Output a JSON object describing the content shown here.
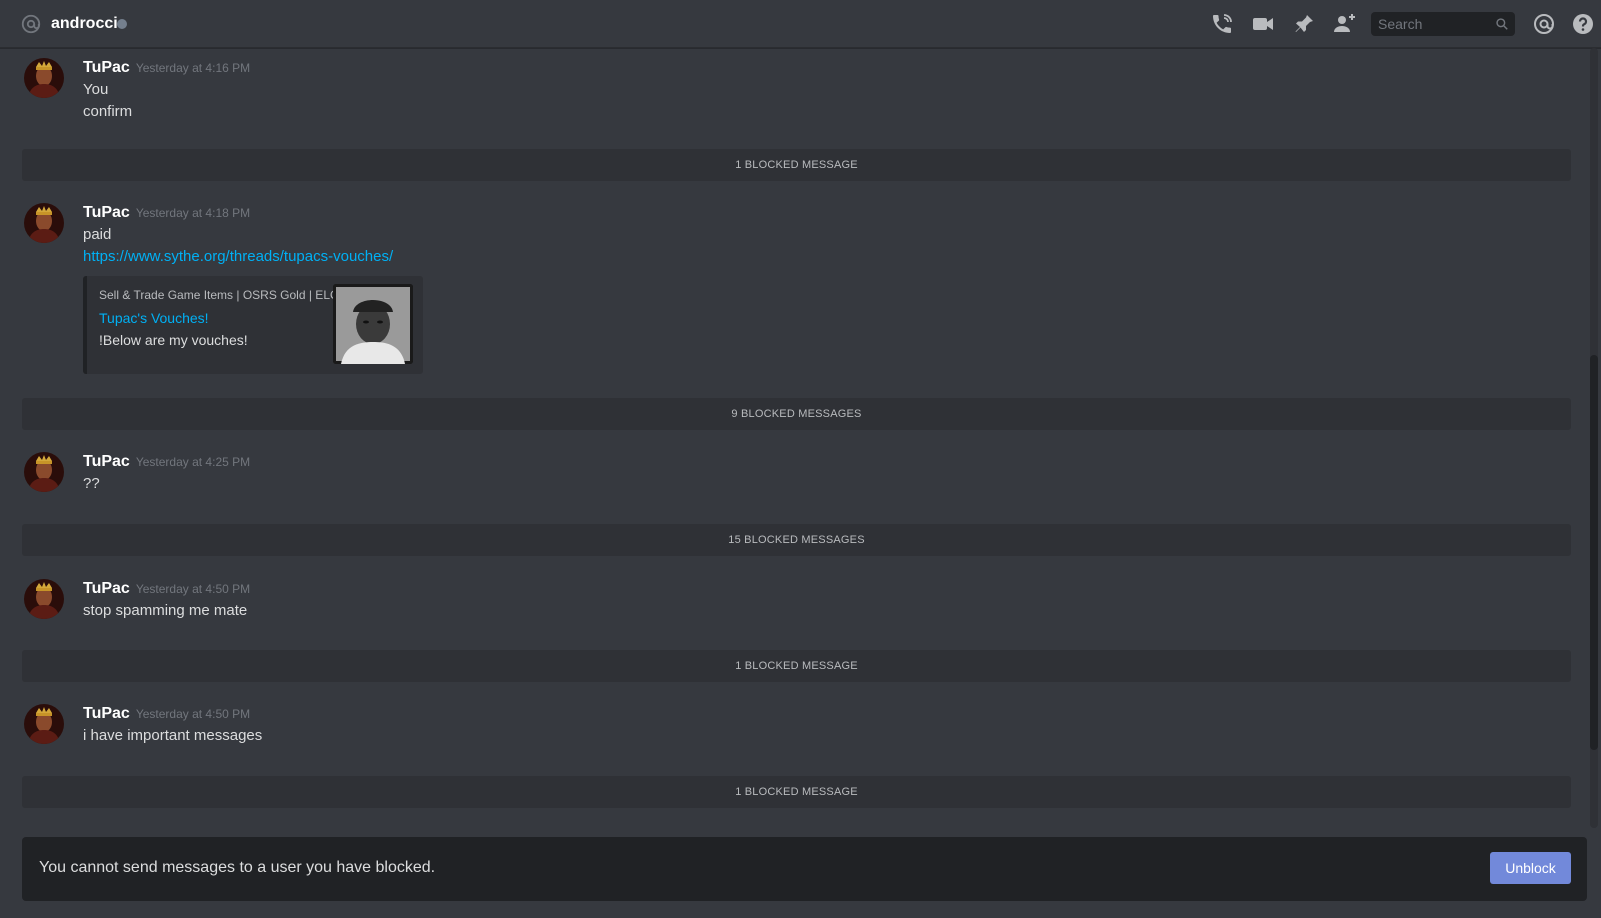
{
  "header": {
    "channel_name": "androcci",
    "search_placeholder": "Search",
    "icons": [
      "at-icon",
      "phone-call-icon",
      "video-camera-icon",
      "pin-icon",
      "add-friend-icon",
      "search-icon",
      "mentions-icon",
      "help-icon"
    ]
  },
  "messages": [
    {
      "author": "TuPac",
      "timestamp": "Yesterday at 4:16 PM",
      "lines": [
        "You",
        "confirm"
      ]
    },
    {
      "author": "TuPac",
      "timestamp": "Yesterday at 4:18 PM",
      "lines": [
        "paid"
      ],
      "link": "https://www.sythe.org/threads/tupacs-vouches/",
      "embed": {
        "provider": "Sell & Trade Game Items | OSRS Gold | ELO",
        "title": "Tupac's Vouches!",
        "description": "!Below are my vouches!"
      }
    },
    {
      "author": "TuPac",
      "timestamp": "Yesterday at 4:25 PM",
      "lines": [
        "??"
      ]
    },
    {
      "author": "TuPac",
      "timestamp": "Yesterday at 4:50 PM",
      "lines": [
        "stop spamming me mate"
      ]
    },
    {
      "author": "TuPac",
      "timestamp": "Yesterday at 4:50 PM",
      "lines": [
        "i have important messages"
      ]
    }
  ],
  "blocked_notices": [
    "1 BLOCKED MESSAGE",
    "9 BLOCKED MESSAGES",
    "15 BLOCKED MESSAGES",
    "1 BLOCKED MESSAGE",
    "1 BLOCKED MESSAGE"
  ],
  "footer": {
    "notice": "You cannot send messages to a user you have blocked.",
    "unblock_label": "Unblock"
  },
  "colors": {
    "background": "#36393f",
    "blocked_bar": "#2f3136",
    "accent_button": "#7289da",
    "link": "#00b0f4"
  }
}
